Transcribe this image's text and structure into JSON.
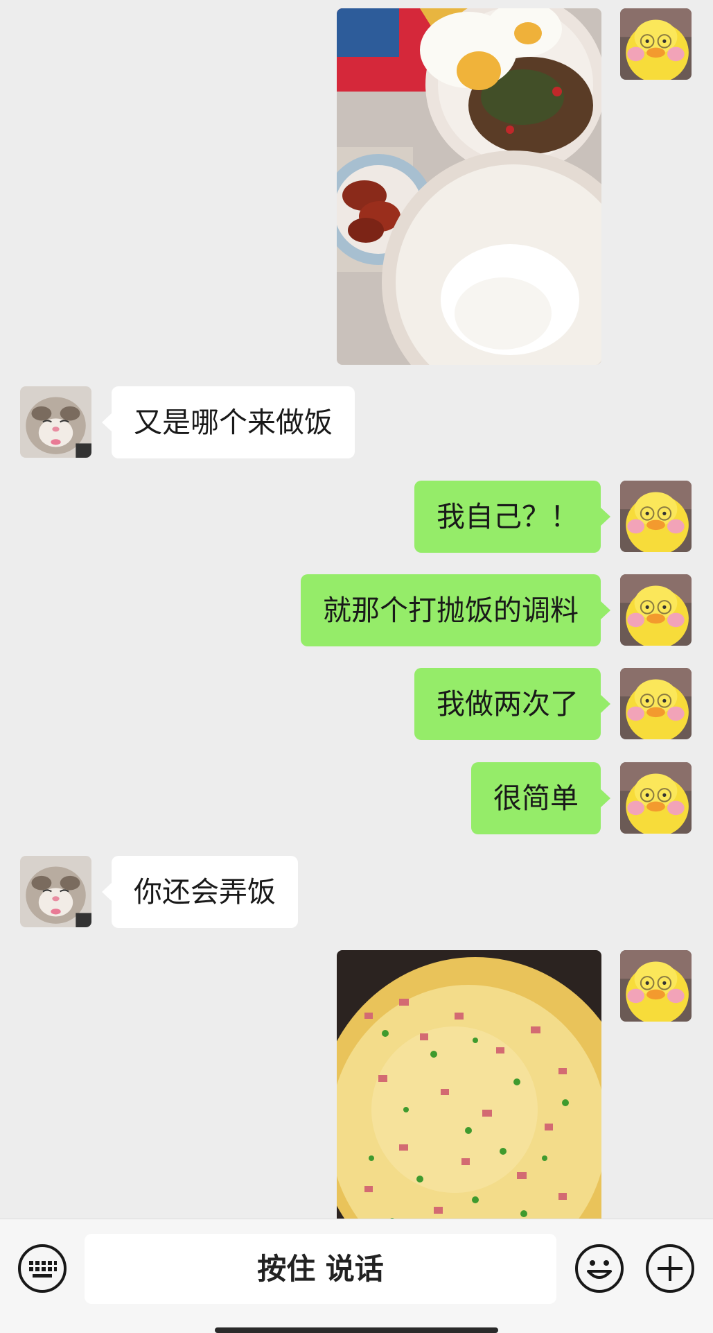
{
  "chat": {
    "messages": [
      {
        "sender": "me",
        "type": "image",
        "content": "food-photo-basil-pork-rice"
      },
      {
        "sender": "them",
        "type": "text",
        "text": "又是哪个来做饭"
      },
      {
        "sender": "me",
        "type": "text",
        "text": "我自己？！"
      },
      {
        "sender": "me",
        "type": "text",
        "text": "就那个打抛饭的调料"
      },
      {
        "sender": "me",
        "type": "text",
        "text": "我做两次了"
      },
      {
        "sender": "me",
        "type": "text",
        "text": "很简单"
      },
      {
        "sender": "them",
        "type": "text",
        "text": "你还会弄饭"
      },
      {
        "sender": "me",
        "type": "image",
        "content": "food-photo-egg-pancake"
      }
    ],
    "avatars": {
      "me": "yellow-duck-avatar",
      "them": "kitten-avatar"
    }
  },
  "input_bar": {
    "voice_button_label": "按住 说话",
    "left_icon": "keyboard-icon",
    "right_icons": [
      "emoji-icon",
      "plus-icon"
    ]
  },
  "colors": {
    "background": "#ededed",
    "my_bubble": "#95ec69",
    "their_bubble": "#ffffff",
    "bottom_bar": "#f6f6f6"
  }
}
